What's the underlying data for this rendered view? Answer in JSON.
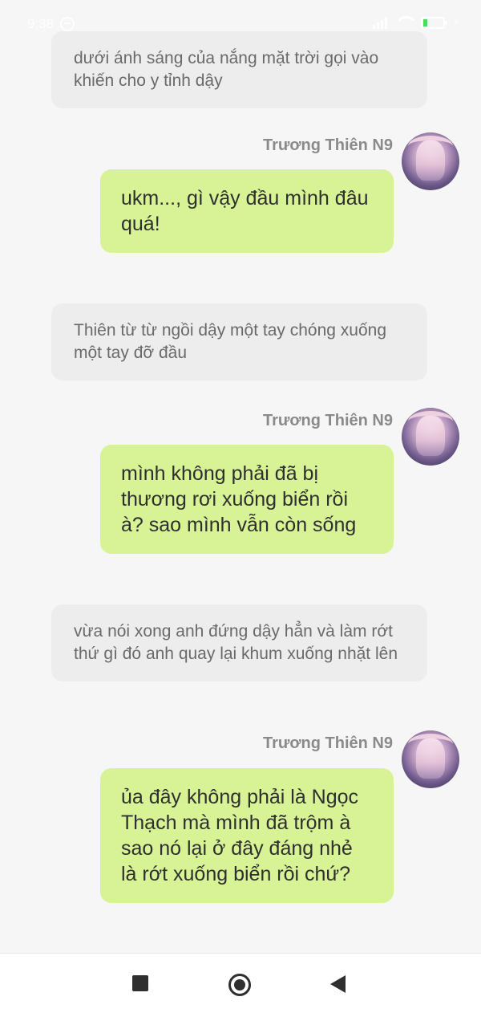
{
  "status_bar": {
    "time": "9:38",
    "battery_color": "#4cd964"
  },
  "messages": [
    {
      "type": "narration",
      "text": "dưới ánh sáng của nắng mặt trời gọi vào khiến cho y tỉnh dậy"
    },
    {
      "type": "chat",
      "sender": "Trương Thiên N9",
      "text": "ukm..., gì vậy đầu mình đâu quá!"
    },
    {
      "type": "narration",
      "text": "Thiên từ từ ngồi dậy một tay chóng xuống một tay đỡ đầu"
    },
    {
      "type": "chat",
      "sender": "Trương Thiên N9",
      "text": "mình không phải đã bị thương rơi xuống biển rồi à? sao mình vẫn còn sống"
    },
    {
      "type": "narration",
      "text": "vừa nói xong anh đứng dậy hẳn và làm rớt thứ gì đó anh quay lại khum xuống nhặt lên"
    },
    {
      "type": "chat",
      "sender": "Trương Thiên N9",
      "text": "ủa đây không phải là Ngọc Thạch mà mình đã trộm à sao nó lại ở đây đáng nhẻ là rớt xuống biển rồi chứ?"
    }
  ],
  "colors": {
    "background": "#f6f6f6",
    "narration_bubble": "#ededed",
    "chat_bubble": "#d7f396",
    "sender_name": "#8a8a8a"
  },
  "nav_bar": {
    "recent_icon": "square-icon",
    "home_icon": "home-circle-icon",
    "back_icon": "back-triangle-icon"
  }
}
